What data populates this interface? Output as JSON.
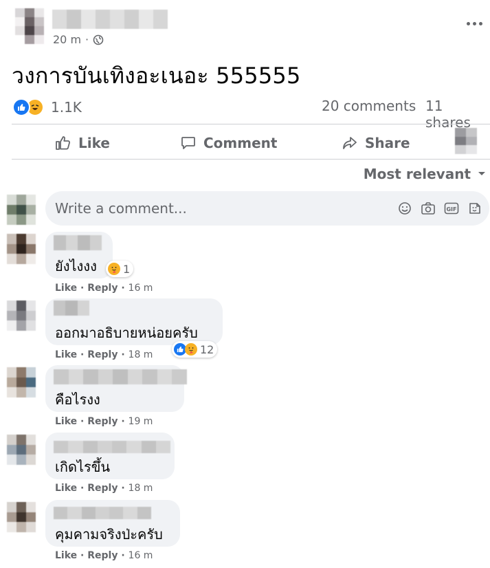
{
  "post": {
    "time": "20 m",
    "separator": "·",
    "privacy_icon": "globe-icon",
    "more_icon": "more-icon",
    "text": "วงการบันเทิงอะเนอะ 555555",
    "reactions_count": "1.1K",
    "reaction_icons": [
      "like-icon",
      "haha-icon"
    ],
    "comments_count": "20 comments",
    "shares_count": "11 shares"
  },
  "actions": {
    "like": "Like",
    "comment": "Comment",
    "share": "Share"
  },
  "sort": {
    "label": "Most relevant"
  },
  "composer": {
    "placeholder": "Write a comment...",
    "icons": [
      "emoji-icon",
      "camera-icon",
      "gif-icon",
      "sticker-icon"
    ]
  },
  "comments": [
    {
      "text": "ยังไงงง",
      "like": "Like",
      "reply": "Reply",
      "time": "16 m",
      "reaction_count": "1",
      "reactions": [
        "care-icon"
      ]
    },
    {
      "text": "ออกมาอธิบายหน่อยครับ",
      "like": "Like",
      "reply": "Reply",
      "time": "18 m",
      "reaction_count": "12",
      "reactions": [
        "like-icon",
        "care-icon"
      ]
    },
    {
      "text": "คือไรงง",
      "like": "Like",
      "reply": "Reply",
      "time": "19 m",
      "reaction_count": "",
      "reactions": []
    },
    {
      "text": "เกิดไรขึ้น",
      "like": "Like",
      "reply": "Reply",
      "time": "18 m",
      "reaction_count": "",
      "reactions": []
    },
    {
      "text": "คุมคามจริงป่ะครับ",
      "like": "Like",
      "reply": "Reply",
      "time": "16 m",
      "reaction_count": "",
      "reactions": []
    }
  ],
  "colors": {
    "like_blue": "#1877f2",
    "haha_yellow": "#f7b125",
    "bubble_bg": "#f0f2f5",
    "secondary_text": "#65676b"
  }
}
